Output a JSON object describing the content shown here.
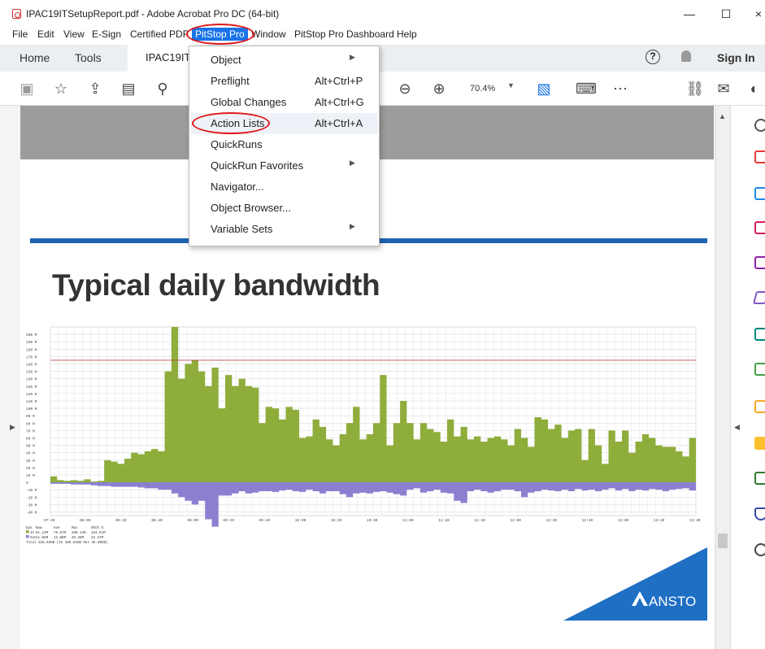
{
  "window": {
    "title": "IPAC19ITSetupReport.pdf - Adobe Acrobat Pro DC (64-bit)",
    "minimize": "—",
    "maximize": "☐",
    "close": "×"
  },
  "menubar": [
    "File",
    "Edit",
    "View",
    "E-Sign",
    "Certified PDF",
    "PitStop Pro",
    "Window",
    "PitStop Pro Dashboard",
    "Help"
  ],
  "tabs": {
    "home": "Home",
    "tools": "Tools",
    "document": "IPAC19IT"
  },
  "header_right": {
    "help": "?",
    "signin": "Sign In"
  },
  "toolbar": {
    "zoom": "70.4%"
  },
  "dropdown": {
    "items": [
      {
        "label": "Object",
        "shortcut": "",
        "submenu": true
      },
      {
        "label": "Preflight",
        "shortcut": "Alt+Ctrl+P",
        "submenu": false
      },
      {
        "label": "Global Changes",
        "shortcut": "Alt+Ctrl+G",
        "submenu": false
      },
      {
        "label": "Action Lists",
        "shortcut": "Alt+Ctrl+A",
        "submenu": false
      },
      {
        "label": "QuickRuns",
        "shortcut": "",
        "submenu": false
      },
      {
        "label": "QuickRun Favorites",
        "shortcut": "",
        "submenu": true
      },
      {
        "label": "Navigator...",
        "shortcut": "",
        "submenu": false
      },
      {
        "label": "Object Browser...",
        "shortcut": "",
        "submenu": false
      },
      {
        "label": "Variable Sets",
        "shortcut": "",
        "submenu": true
      }
    ]
  },
  "document": {
    "heading": "Typical daily bandwidth",
    "logo": "ANSTO"
  },
  "chart_data": {
    "type": "area",
    "y_ticks": [
      "200 M",
      "190 M",
      "180 M",
      "170 M",
      "160 M",
      "150 M",
      "140 M",
      "130 M",
      "120 M",
      "110 M",
      "100 M",
      "90 M",
      "80 M",
      "70 M",
      "60 M",
      "50 M",
      "40 M",
      "30 M",
      "20 M",
      "10 M",
      "0",
      "-10 M",
      "-20 M",
      "-30 M",
      "-40 M"
    ],
    "x_ticks": [
      "07:40",
      "08:00",
      "08:20",
      "08:40",
      "09:00",
      "09:20",
      "09:40",
      "10:00",
      "10:20",
      "10:40",
      "11:00",
      "11:20",
      "11:40",
      "12:00",
      "12:20",
      "12:40",
      "13:00",
      "13:20",
      "13:40"
    ],
    "threshold": 165,
    "series": [
      {
        "name": "In",
        "color": "#8fad3b",
        "values": [
          8,
          3,
          2,
          3,
          2,
          4,
          1,
          2,
          30,
          28,
          25,
          32,
          40,
          38,
          42,
          45,
          42,
          150,
          210,
          140,
          160,
          165,
          150,
          130,
          155,
          100,
          145,
          130,
          140,
          130,
          128,
          80,
          102,
          100,
          85,
          102,
          98,
          60,
          62,
          85,
          75,
          58,
          50,
          65,
          80,
          102,
          58,
          65,
          80,
          145,
          50,
          80,
          110,
          80,
          58,
          80,
          72,
          68,
          55,
          85,
          62,
          75,
          58,
          62,
          55,
          60,
          62,
          58,
          50,
          72,
          60,
          48,
          88,
          85,
          72,
          78,
          60,
          70,
          72,
          30,
          72,
          50,
          25,
          70,
          55,
          70,
          40,
          55,
          65,
          60,
          50,
          48,
          48,
          42,
          35,
          60
        ]
      },
      {
        "name": "Out",
        "color": "#8b80d0",
        "values": [
          2,
          2,
          2,
          3,
          3,
          3,
          4,
          5,
          5,
          6,
          6,
          6,
          6,
          7,
          8,
          8,
          10,
          10,
          15,
          20,
          25,
          30,
          25,
          50,
          60,
          18,
          18,
          15,
          12,
          15,
          14,
          12,
          12,
          13,
          11,
          10,
          12,
          13,
          10,
          12,
          15,
          12,
          12,
          16,
          20,
          15,
          14,
          15,
          13,
          12,
          14,
          16,
          18,
          10,
          8,
          14,
          12,
          10,
          14,
          15,
          25,
          28,
          12,
          10,
          12,
          14,
          12,
          10,
          10,
          12,
          20,
          14,
          12,
          10,
          11,
          12,
          10,
          12,
          9,
          11,
          10,
          12,
          10,
          8,
          11,
          9,
          12,
          10,
          11,
          9,
          10,
          12,
          10,
          9,
          8,
          11
        ]
      }
    ],
    "legend": {
      "header": [
        "bps",
        "Now",
        "Ave",
        "Max",
        "95th %"
      ],
      "rows": [
        [
          "In",
          "61.14M",
          "79.57M",
          "208.14M",
          "164.61M"
        ],
        [
          "Out",
          "11.66M",
          "13.88M",
          "46.36M",
          "23.47M"
        ]
      ],
      "total": "Total 225.63GB (In 188.54GB Out 35.09GB)"
    }
  }
}
